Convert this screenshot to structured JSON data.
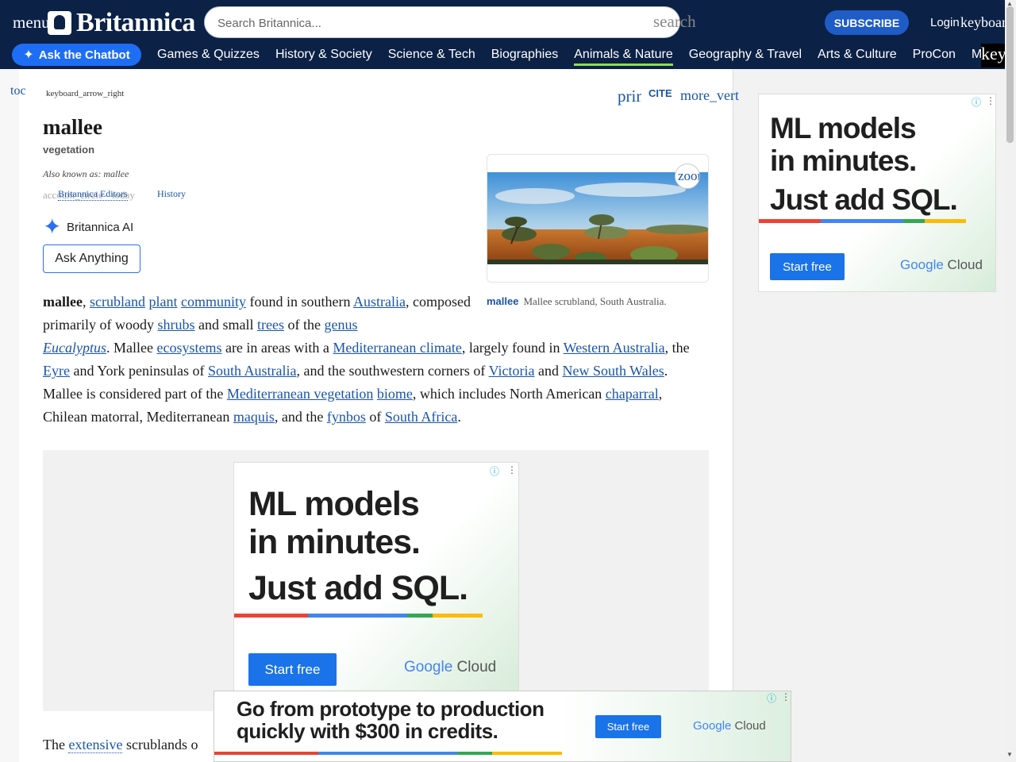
{
  "header": {
    "menu_icon": "menu",
    "logo_text": "Britannica",
    "search_placeholder": "Search Britannica...",
    "search_icon": "search",
    "subscribe": "SUBSCRIBE",
    "login": "Login",
    "keyboard_icon": "keyboard_arrow_down",
    "chatbot": "Ask the Chatbot",
    "nav": [
      "Games & Quizzes",
      "History & Society",
      "Science & Tech",
      "Biographies",
      "Animals & Nature",
      "Geography & Travel",
      "Arts & Culture",
      "ProCon",
      "Mo"
    ],
    "nav_active_index": 4,
    "nav_more_icon": "key"
  },
  "toolbar": {
    "toc_icon": "toc",
    "arrow_icon": "keyboard_arrow_right",
    "print_icon": "print",
    "cite": "CITE",
    "more_icon": "more_vert"
  },
  "article": {
    "title": "mallee",
    "subtitle": "vegetation",
    "aka": "Also known as: mallee",
    "byline_icon": "account_circle",
    "editors": "Britannica Editors",
    "history_icon": "today",
    "history": "History",
    "ai_label": "Britannica AI",
    "ask_btn": "Ask Anything",
    "zoom_icon": "zoom_in",
    "caption_label": "mallee",
    "caption": "Mallee scrubland, South Australia.",
    "p1": {
      "w0": "mallee",
      "w1": "scrubland",
      "w2": "plant",
      "w3": "community",
      "t1": " found in southern ",
      "w4": "Australia",
      "t2": "composed primarily of woody ",
      "w5": "shrubs",
      "t3": " and small ",
      "w6": "trees",
      "t4": " of the ",
      "w7": "genus",
      "w8": "Eucalyptus",
      "t5": ". Mallee ",
      "w9": "ecosystems",
      "t6": " are in areas with a ",
      "w10": "Mediterranean climate",
      "t7": ", largely found in ",
      "w11": "Western Australia",
      "t8": ", the ",
      "w12": "Eyre",
      "t9": " and York peninsulas of ",
      "w13": "South Australia",
      "t10": ", and the southwestern corners of ",
      "w14": "Victoria",
      "t11": " and",
      "w15": "New South Wales",
      "t12": ". Mallee is considered part of the ",
      "w16": "Mediterranean vegetation",
      "w17": "biome",
      "t13": ", which includes",
      "t14": "North American ",
      "w18": "chaparral",
      "t15": ", Chilean matorral, Mediterranean ",
      "w19": "maquis",
      "t16": ", and the ",
      "w20": "fynbos",
      "t17": " of ",
      "w21": "South Africa"
    },
    "p2_start": "The ",
    "p2_link": "extensive",
    "p2_rest": " scrublands o"
  },
  "ads": {
    "side": {
      "line1": "ML models",
      "line2": "in minutes.",
      "line3": "Just add SQL.",
      "btn": "Start free",
      "brand_google": "Google",
      "brand_cloud": " Cloud"
    },
    "inline": {
      "line1": "ML models",
      "line2": "in minutes.",
      "line3": "Just add SQL.",
      "btn": "Start free",
      "brand_google": "Google",
      "brand_cloud": " Cloud"
    },
    "sticky": {
      "line1": "Go from prototype to production",
      "line2": "quickly with $300 in credits.",
      "btn": "Start free",
      "brand_google": "Google",
      "brand_cloud": " Cloud"
    },
    "info_icon": "ⓘ",
    "dots_icon": "⋮"
  },
  "colors": {
    "header_bg": "#0b2146",
    "link": "#1a55a8",
    "accent_blue": "#1e6ef5",
    "active_underline": "#8fdc4c"
  }
}
